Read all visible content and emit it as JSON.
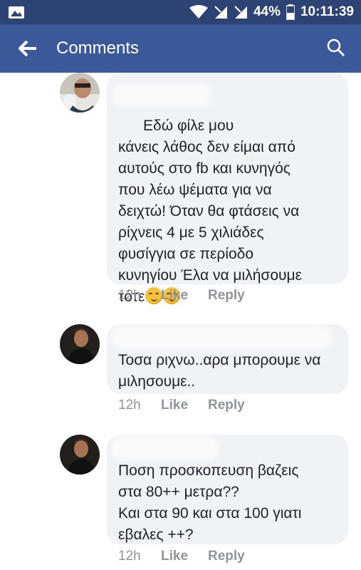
{
  "status": {
    "battery": "44%",
    "time": "10:11:39"
  },
  "header": {
    "title": "Comments"
  },
  "comments": [
    {
      "text": "Εδώ φίλε μου\nκάνεις λάθος δεν είμαι από\nαυτούς στο fb και κυνηγός\nπου λέω ψέματα για να\nδειχτώ! Όταν θα φτάσεις να\nρίχνεις 4 με 5 χιλιάδες\nφυσίγγια σε περίοδο\nκυνηγίου Έλα να μιλήσουμε\nτότε",
      "time": "12h",
      "like": "Like",
      "reply": "Reply"
    },
    {
      "text": "Τοσα ριχνω..αρα μπορουμε να\nμιλησουμε..",
      "time": "12h",
      "like": "Like",
      "reply": "Reply"
    },
    {
      "text": "Ποση προσκοπευση βαζεις\nστα 80++ μετρα??\nΚαι στα 90 και στα 100 γιατι\nεβαλες ++?",
      "time": "12h",
      "like": "Like",
      "reply": "Reply"
    }
  ]
}
